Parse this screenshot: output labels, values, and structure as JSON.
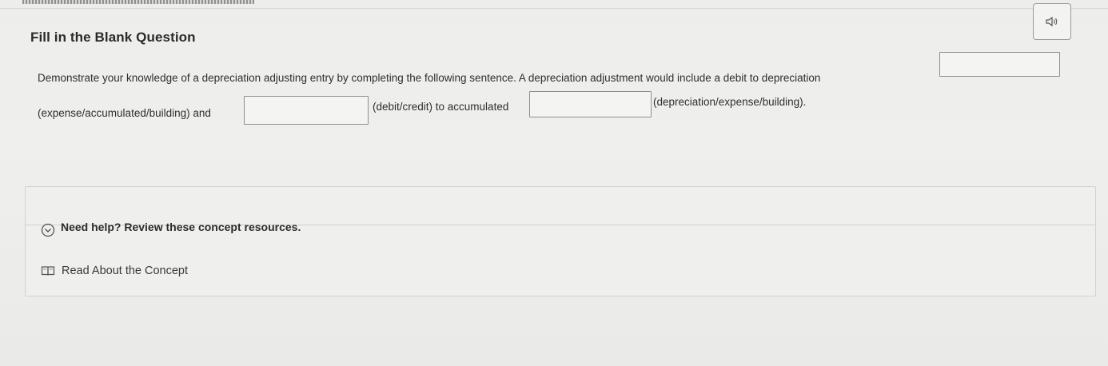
{
  "header": {
    "title": "Fill in the Blank Question",
    "audio_icon": "speaker-icon"
  },
  "question": {
    "part1": "Demonstrate your knowledge of a depreciation adjusting entry by completing the following sentence. A depreciation adjustment would include a debit to depreciation",
    "part2": "(expense/accumulated/building) and",
    "part3": "(debit/credit) to accumulated",
    "part4": "(depreciation/expense/building).",
    "blanks": [
      {
        "value": "",
        "placeholder": ""
      },
      {
        "value": "",
        "placeholder": ""
      },
      {
        "value": "",
        "placeholder": ""
      }
    ]
  },
  "help": {
    "toggle_label": "Need help? Review these concept resources.",
    "toggle_icon": "chevron-down-circle-icon",
    "resources": [
      {
        "label": "Read About the Concept",
        "icon": "book-icon"
      }
    ]
  },
  "colors": {
    "background": "#eeeeec",
    "text": "#2e2e2e",
    "border": "#8f8f8f"
  }
}
